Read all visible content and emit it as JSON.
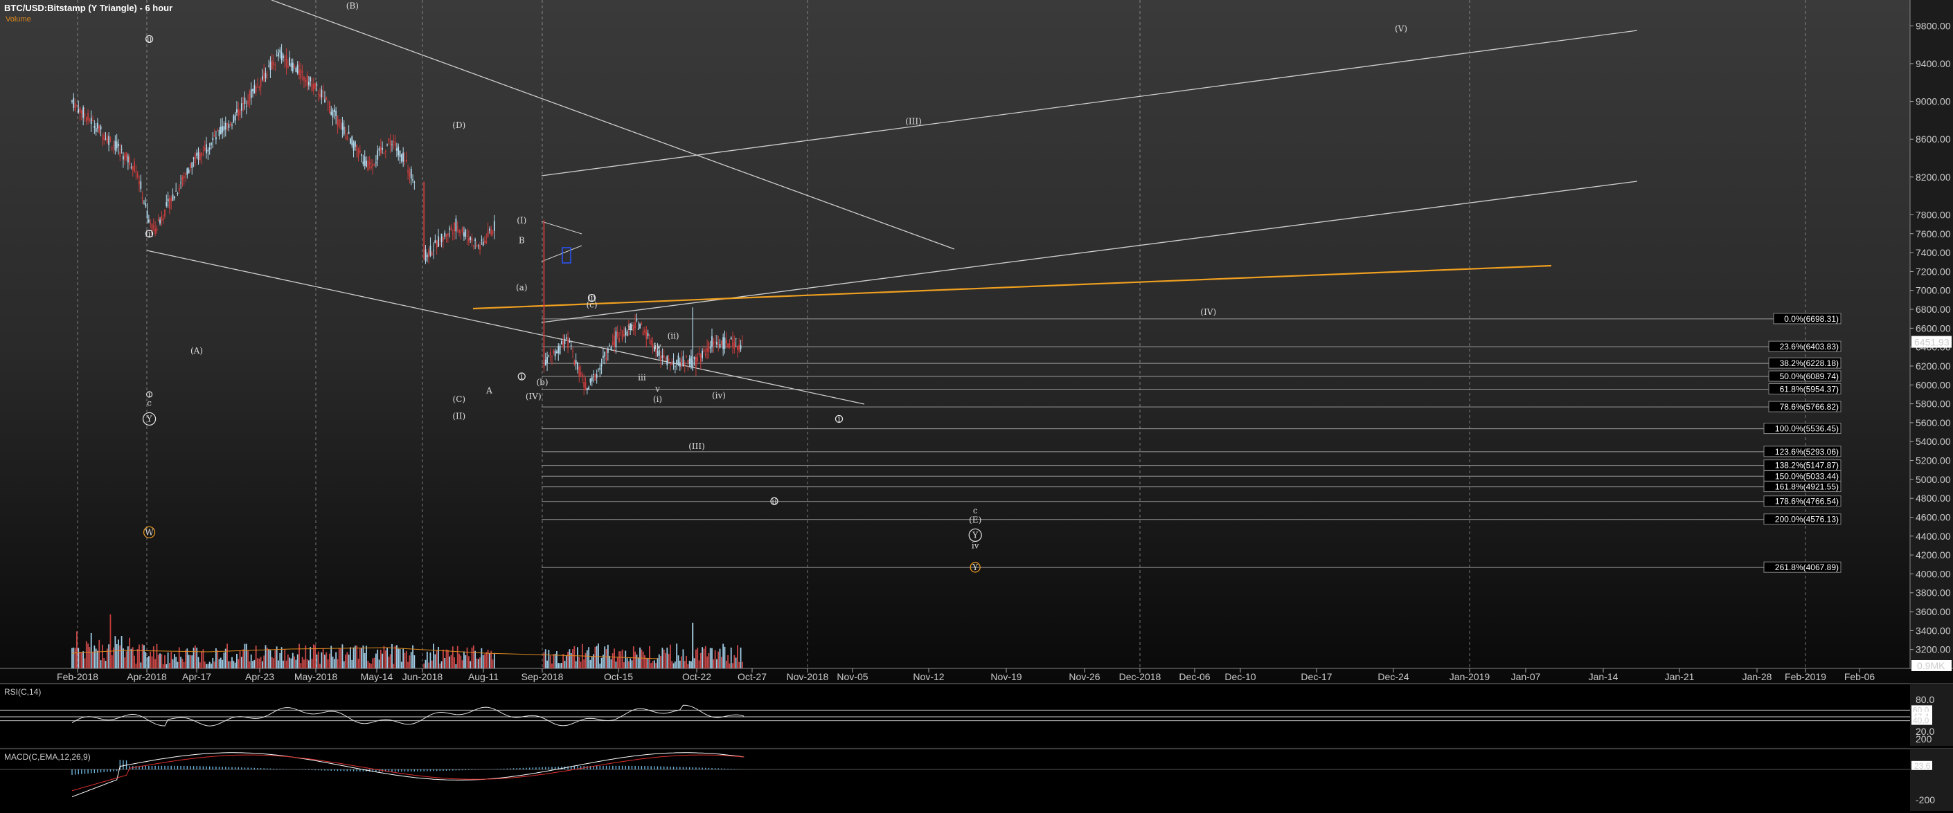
{
  "header": {
    "title": "BTC/USD:Bitstamp (Y Triangle) - 6 hour",
    "volume_label": "Volume"
  },
  "colors": {
    "bull": "#b4dcf0",
    "bear": "#c83c3c",
    "fib_line": "#9a9a9a",
    "trend_line": "#cfcfcf",
    "orange": "#f0a020",
    "red_label": "#d22",
    "white_label": "#e8e8e8"
  },
  "chart_data": [
    {
      "type": "candlestick",
      "title": "BTC/USD:Bitstamp (Y Triangle) - 6 hour",
      "price_axis": {
        "ylim": [
          3000,
          10000
        ],
        "ticks": [
          9800,
          9400,
          9000,
          8600,
          8200,
          7800,
          7600,
          7400,
          7200,
          7000,
          6800,
          6600,
          6400,
          6200,
          6000,
          5800,
          5600,
          5400,
          5200,
          5000,
          4800,
          4600,
          4400,
          4200,
          4000,
          3800,
          3600,
          3400,
          3200
        ],
        "tick_labels": [
          "9800.00",
          "9400.00",
          "9000.00",
          "8600.00",
          "8200.00",
          "7800.00",
          "7600.00",
          "7400.00",
          "7200.00",
          "7000.00",
          "6800.00",
          "6600.00",
          "6400.00",
          "6200.00",
          "6000.00",
          "5800.00",
          "5600.00",
          "5400.00",
          "5200.00",
          "5000.00",
          "4800.00",
          "4600.00",
          "4400.00",
          "4200.00",
          "4000.00",
          "3800.00",
          "3600.00",
          "3400.00",
          "3200.00"
        ],
        "last_price": "6451.93",
        "volume_last": "0.9MK"
      },
      "x_axis": {
        "tick_labels": [
          "Feb-2018",
          "Apr-2018",
          "Apr-17",
          "Apr-23",
          "May-2018",
          "May-14",
          "Jun-2018",
          "Aug-11",
          "Sep-2018",
          "Oct-15",
          "Oct-22",
          "Oct-27",
          "Nov-2018",
          "Nov-05",
          "Nov-12",
          "Nov-19",
          "Nov-26",
          "Dec-2018",
          "Dec-06",
          "Dec-10",
          "Dec-17",
          "Dec-24",
          "Jan-2019",
          "Jan-07",
          "Jan-14",
          "Jan-21",
          "Jan-28",
          "Feb-2019",
          "Feb-06"
        ],
        "grid_at": [
          "Feb-2018",
          "Apr-2018",
          "May-2018",
          "Jun-2018",
          "Sep-2018",
          "Nov-2018",
          "Dec-2018",
          "Jan-2019",
          "Feb-2019"
        ]
      },
      "fib_levels": [
        {
          "ratio": "0.0%",
          "price": 6698.31,
          "label": "0.0%(6698.31)"
        },
        {
          "ratio": "23.6%",
          "price": 6403.83,
          "label": "23.6%(6403.83)"
        },
        {
          "ratio": "38.2%",
          "price": 6228.18,
          "label": "38.2%(6228.18)"
        },
        {
          "ratio": "50.0%",
          "price": 6089.74,
          "label": "50.0%(6089.74)"
        },
        {
          "ratio": "61.8%",
          "price": 5954.37,
          "label": "61.8%(5954.37)"
        },
        {
          "ratio": "78.6%",
          "price": 5766.82,
          "label": "78.6%(5766.82)"
        },
        {
          "ratio": "100.0%",
          "price": 5536.45,
          "label": "100.0%(5536.45)"
        },
        {
          "ratio": "123.6%",
          "price": 5293.06,
          "label": "123.6%(5293.06)"
        },
        {
          "ratio": "138.2%",
          "price": 5147.87,
          "label": "138.2%(5147.87)"
        },
        {
          "ratio": "150.0%",
          "price": 5033.44,
          "label": "150.0%(5033.44)"
        },
        {
          "ratio": "161.8%",
          "price": 4921.55,
          "label": "161.8%(4921.55)"
        },
        {
          "ratio": "178.6%",
          "price": 4766.54,
          "label": "178.6%(4766.54)"
        },
        {
          "ratio": "200.0%",
          "price": 4576.13,
          "label": "200.0%(4576.13)"
        },
        {
          "ratio": "261.8%",
          "price": 4067.89,
          "label": "261.8%(4067.89)"
        }
      ],
      "segments": [
        {
          "bar0": 0,
          "bar1": 40,
          "from": 9000,
          "to": 8300
        },
        {
          "bar0": 40,
          "bar1": 50,
          "from": 8300,
          "to": 7600
        },
        {
          "bar0": 50,
          "bar1": 75,
          "from": 7600,
          "to": 8350
        },
        {
          "bar0": 75,
          "bar1": 100,
          "from": 8350,
          "to": 8800
        },
        {
          "bar0": 100,
          "bar1": 130,
          "from": 8800,
          "to": 9500
        },
        {
          "bar0": 130,
          "bar1": 155,
          "from": 9500,
          "to": 9100
        },
        {
          "bar0": 155,
          "bar1": 185,
          "from": 9100,
          "to": 8300
        },
        {
          "bar0": 185,
          "bar1": 200,
          "from": 8300,
          "to": 8600
        },
        {
          "bar0": 200,
          "bar1": 215,
          "from": 8600,
          "to": 8150
        },
        {
          "bar0": 220,
          "bar1": 240,
          "from": 7350,
          "to": 7700
        },
        {
          "bar0": 240,
          "bar1": 255,
          "from": 7700,
          "to": 7450
        },
        {
          "bar0": 255,
          "bar1": 265,
          "from": 7450,
          "to": 7700
        },
        {
          "bar0": 295,
          "bar1": 310,
          "from": 6250,
          "to": 6450
        },
        {
          "bar0": 310,
          "bar1": 322,
          "from": 6450,
          "to": 5950
        },
        {
          "bar0": 322,
          "bar1": 340,
          "from": 5950,
          "to": 6500
        },
        {
          "bar0": 340,
          "bar1": 355,
          "from": 6500,
          "to": 6650
        },
        {
          "bar0": 355,
          "bar1": 370,
          "from": 6650,
          "to": 6250
        },
        {
          "bar0": 370,
          "bar1": 390,
          "from": 6250,
          "to": 6250
        },
        {
          "bar0": 390,
          "bar1": 400,
          "from": 6250,
          "to": 6450
        },
        {
          "bar0": 400,
          "bar1": 420,
          "from": 6450,
          "to": 6420
        }
      ],
      "wave_labels": [
        {
          "text": "(B)",
          "date_idx": 4.6,
          "price": 9980,
          "color": "white"
        },
        {
          "text": "(D)",
          "date_idx": 6.6,
          "price": 8720,
          "color": "white"
        },
        {
          "text": "(A)",
          "date_idx": 2.0,
          "price": 6330,
          "color": "white"
        },
        {
          "text": "(C)",
          "date_idx": 6.6,
          "price": 5820,
          "color": "white"
        },
        {
          "text": "(II)",
          "date_idx": 6.6,
          "price": 5640,
          "color": "red"
        },
        {
          "text": "A",
          "date_idx": 7.1,
          "price": 5910,
          "color": "white"
        },
        {
          "text": "B",
          "date_idx": 7.65,
          "price": 7500,
          "color": "white"
        },
        {
          "text": "(a)",
          "date_idx": 7.65,
          "price": 7000,
          "color": "white"
        },
        {
          "text": "(b)",
          "date_idx": 8.0,
          "price": 6000,
          "color": "white"
        },
        {
          "text": "(c)",
          "date_idx": 8.65,
          "price": 6820,
          "color": "white"
        },
        {
          "text": "(ii)",
          "date_idx": 9.7,
          "price": 6490,
          "color": "white"
        },
        {
          "text": "ii",
          "date_idx": 9.15,
          "price": 6580,
          "color": "white"
        },
        {
          "text": "iv",
          "date_idx": 9.5,
          "price": 6380,
          "color": "white"
        },
        {
          "text": "iii",
          "date_idx": 9.3,
          "price": 6050,
          "color": "white"
        },
        {
          "text": "v",
          "date_idx": 9.5,
          "price": 5930,
          "color": "white"
        },
        {
          "text": "(i)",
          "date_idx": 9.5,
          "price": 5820,
          "color": "white"
        },
        {
          "text": "(iv)",
          "date_idx": 10.4,
          "price": 5860,
          "color": "white"
        },
        {
          "text": "(III)",
          "date_idx": 10.0,
          "price": 5320,
          "color": "white"
        },
        {
          "text": "(III)",
          "date_idx": 13.8,
          "price": 8760,
          "color": "red"
        },
        {
          "text": "(IV)",
          "date_idx": 18.3,
          "price": 6740,
          "color": "red"
        },
        {
          "text": "(V)",
          "date_idx": 21.1,
          "price": 9740,
          "color": "red"
        },
        {
          "text": "c",
          "date_idx": 14.6,
          "price": 4640,
          "color": "white"
        },
        {
          "text": "(E)",
          "date_idx": 14.6,
          "price": 4540,
          "color": "white"
        },
        {
          "text": "iv",
          "date_idx": 14.6,
          "price": 4270,
          "color": "white"
        },
        {
          "text": "c",
          "date_idx": 1.05,
          "price": 5780,
          "color": "white"
        },
        {
          "text": "(I)",
          "date_idx": 7.65,
          "price": 7710,
          "color": "red"
        },
        {
          "text": "(IV)",
          "date_idx": 7.85,
          "price": 5850,
          "color": "red"
        }
      ],
      "circled_labels": [
        {
          "text": "Y",
          "date_idx": 1.05,
          "price": 5640,
          "color": "white",
          "size": 9
        },
        {
          "text": "Y",
          "date_idx": 14.6,
          "price": 4410,
          "color": "white",
          "size": 9
        },
        {
          "text": "W",
          "date_idx": 1.05,
          "price": 4440,
          "color": "orange",
          "size": 8
        },
        {
          "text": "Y",
          "date_idx": 14.6,
          "price": 4070,
          "color": "orange",
          "size": 7
        },
        {
          "text": "ii",
          "date_idx": 1.05,
          "price": 9660,
          "color": "white",
          "size": 5
        },
        {
          "text": "iii",
          "date_idx": 1.05,
          "price": 7600,
          "color": "white",
          "size": 5
        },
        {
          "text": "iii",
          "date_idx": 8.65,
          "price": 6920,
          "color": "white",
          "size": 5
        },
        {
          "text": "i",
          "date_idx": 7.65,
          "price": 6090,
          "color": "white",
          "size": 5
        },
        {
          "text": "i",
          "date_idx": 12.7,
          "price": 5640,
          "color": "white",
          "size": 5
        },
        {
          "text": "ii",
          "date_idx": 11.4,
          "price": 4770,
          "color": "white",
          "size": 5
        },
        {
          "text": "i",
          "date_idx": 1.05,
          "price": 5900,
          "color": "white",
          "size": 4
        }
      ]
    },
    {
      "type": "line",
      "title": "RSI(C,14)",
      "ylim": [
        0,
        100
      ],
      "ticks": [
        80.0,
        20.0
      ],
      "tick_labels": [
        "80.0",
        "20.0"
      ],
      "levels": [
        60.0,
        47.4,
        40.0
      ],
      "level_labels": [
        "60.0",
        "47.4",
        "40.0"
      ]
    },
    {
      "type": "line",
      "title": "MACD(C,EMA,12,26,9)",
      "ticks": [
        200,
        -200
      ],
      "tick_labels": [
        "200",
        "-200"
      ],
      "last_value": "23.6"
    }
  ],
  "footer": {
    "watermark": ""
  }
}
